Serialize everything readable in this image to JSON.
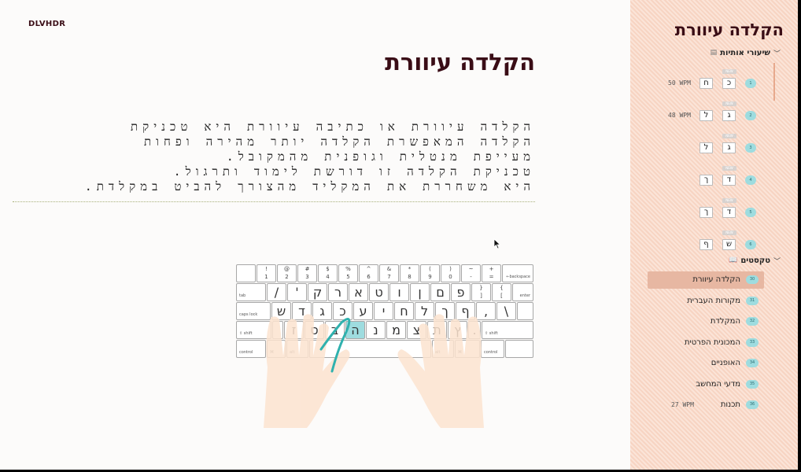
{
  "header": {
    "brand": "DLVHDR",
    "title": "הקלדה עיוורת"
  },
  "lesson_text": [
    "הקלדה עיוורת או כתיבה עיוורת היא טכניקת",
    "הקלדה המאפשרת הקלדה יותר מהירה ופחות",
    "מעייפת מנטלית וגופנית מהמקובל.",
    "טכניקת הקלדה זו דורשת לימוד ותרגול.",
    "היא משחררת את המקליד מהצורך להביט במקלדת."
  ],
  "keyboard": {
    "row1": [
      {
        "top": "!",
        "bot": "1"
      },
      {
        "top": "@",
        "bot": "2"
      },
      {
        "top": "#",
        "bot": "3"
      },
      {
        "top": "$",
        "bot": "4"
      },
      {
        "top": "%",
        "bot": "5"
      },
      {
        "top": "^",
        "bot": "6"
      },
      {
        "top": "&",
        "bot": "7"
      },
      {
        "top": "*",
        "bot": "8"
      },
      {
        "top": "(",
        "bot": "9"
      },
      {
        "top": ")",
        "bot": "0"
      },
      {
        "top": "~",
        "bot": "-"
      },
      {
        "top": "+",
        "bot": "="
      }
    ],
    "row2": [
      "/",
      "'",
      "ק",
      "ר",
      "א",
      "ט",
      "ו",
      "ן",
      "ם",
      "פ"
    ],
    "row2_brackets": [
      {
        "top": "}",
        "bot": "]"
      },
      {
        "top": "{",
        "bot": "["
      }
    ],
    "row3": [
      "ש",
      "ד",
      "ג",
      "כ",
      "ע",
      "י",
      "ח",
      "ל",
      "ך",
      "ף",
      ",",
      "\\"
    ],
    "row4": [
      "ז",
      "ס",
      "ב",
      "ה",
      "נ",
      "מ",
      "צ",
      "ת",
      "ץ",
      "."
    ],
    "labels": {
      "backspace": "←backspace",
      "tab": "tab",
      "enter": "enter",
      "caps": "caps lock",
      "shift_left": "⇧ shift",
      "shift_right": "⇧ shift",
      "control_left": "control",
      "control_right": "control",
      "alt_left": "alt",
      "alt_right": "alt",
      "cmd": "⌘"
    },
    "target_key": "ה"
  },
  "sidebar": {
    "title": "הקלדה עיוורת",
    "letters_section": {
      "label": "שיעורי אותיות",
      "icon": "list-icon"
    },
    "lessons": [
      {
        "num": "1",
        "k1": "כ",
        "k2": "ח",
        "tag": "NEW",
        "wpm": "50 WPM"
      },
      {
        "num": "2",
        "k1": "ג",
        "k2": "ל",
        "tag": "NEW",
        "wpm": "48 WPM"
      },
      {
        "num": "3",
        "k1": "ג",
        "k2": "ל",
        "tag": "NEW",
        "wpm": ""
      },
      {
        "num": "4",
        "k1": "ד",
        "k2": "ך",
        "tag": "NEW",
        "wpm": ""
      },
      {
        "num": "5",
        "k1": "ד",
        "k2": "ך",
        "tag": "NEW",
        "wpm": ""
      },
      {
        "num": "6",
        "k1": "ש",
        "k2": "ף",
        "tag": "NEW",
        "wpm": ""
      }
    ],
    "texts_section": {
      "label": "טקסטים",
      "icon": "book-icon"
    },
    "texts": [
      {
        "num": "30",
        "label": "הקלדה עיוורת",
        "wpm": "",
        "active": true
      },
      {
        "num": "31",
        "label": "מקורות העברית",
        "wpm": ""
      },
      {
        "num": "32",
        "label": "המקלדת",
        "wpm": ""
      },
      {
        "num": "33",
        "label": "המכונית הפרטית",
        "wpm": ""
      },
      {
        "num": "34",
        "label": "האופניים",
        "wpm": ""
      },
      {
        "num": "35",
        "label": "מדעי המחשב",
        "wpm": ""
      },
      {
        "num": "36",
        "label": "תכנות",
        "wpm": "27 WPM"
      }
    ]
  }
}
